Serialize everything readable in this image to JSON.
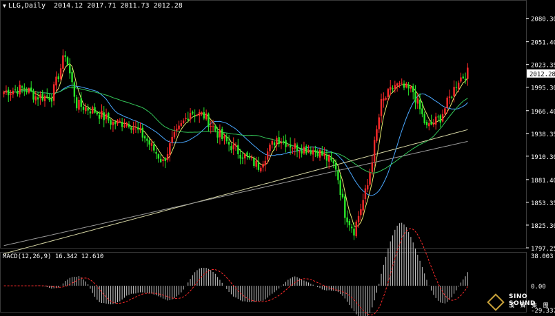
{
  "header": {
    "symbol": "LLG,Daily",
    "open": "2014.12",
    "high": "2017.71",
    "low": "2011.73",
    "close": "2012.28"
  },
  "price_panel": {
    "y_ticks": [
      "2080.30",
      "2051.40",
      "2023.35",
      "1995.30",
      "1966.40",
      "1938.35",
      "1910.30",
      "1881.40",
      "1853.35",
      "1825.30",
      "1797.25"
    ],
    "current_price": "2012.28"
  },
  "macd_panel": {
    "label": "MACD(12,26,9) 16.342 12.610",
    "y_ticks": [
      "38.003",
      "0.00",
      "-29.337"
    ]
  },
  "logo": {
    "brand": "SINO SOUND",
    "brand_cn": "漢 聲 集 團"
  },
  "colors": {
    "up": "#ff2a2a",
    "down": "#29e829",
    "ma5": "#e8e86e",
    "ma10": "#4aa8ff",
    "ma20": "#34c759",
    "ma60": "#d8d8a6",
    "ma200": "#9a9a9a",
    "macd_hist": "#c8c8c8",
    "macd_signal": "#ff2a2a",
    "grid": "#3a3a3a"
  },
  "chart_data": {
    "type": "candlestick",
    "ylim": [
      1797.25,
      2091
    ],
    "key_points": [
      [
        0,
        1990
      ],
      [
        9,
        1994
      ],
      [
        14,
        1984
      ],
      [
        21,
        1984
      ],
      [
        27,
        2037
      ],
      [
        32,
        1974
      ],
      [
        40,
        1966
      ],
      [
        48,
        1951
      ],
      [
        55,
        1952
      ],
      [
        62,
        1933
      ],
      [
        70,
        1903
      ],
      [
        74,
        1929
      ],
      [
        82,
        1966
      ],
      [
        88,
        1960
      ],
      [
        96,
        1932
      ],
      [
        103,
        1916
      ],
      [
        112,
        1898
      ],
      [
        120,
        1933
      ],
      [
        128,
        1922
      ],
      [
        138,
        1917
      ],
      [
        146,
        1897
      ],
      [
        150,
        1840
      ],
      [
        154,
        1819
      ],
      [
        160,
        1874
      ],
      [
        166,
        1975
      ],
      [
        172,
        1998
      ],
      [
        180,
        1990
      ],
      [
        186,
        1945
      ],
      [
        192,
        1958
      ],
      [
        200,
        2005
      ],
      [
        204,
        2013
      ]
    ],
    "macd": {
      "label": "MACD(12,26,9)",
      "macd_value": 16.342,
      "signal_value": 12.61,
      "ylim": [
        -29.337,
        38.003
      ]
    }
  }
}
